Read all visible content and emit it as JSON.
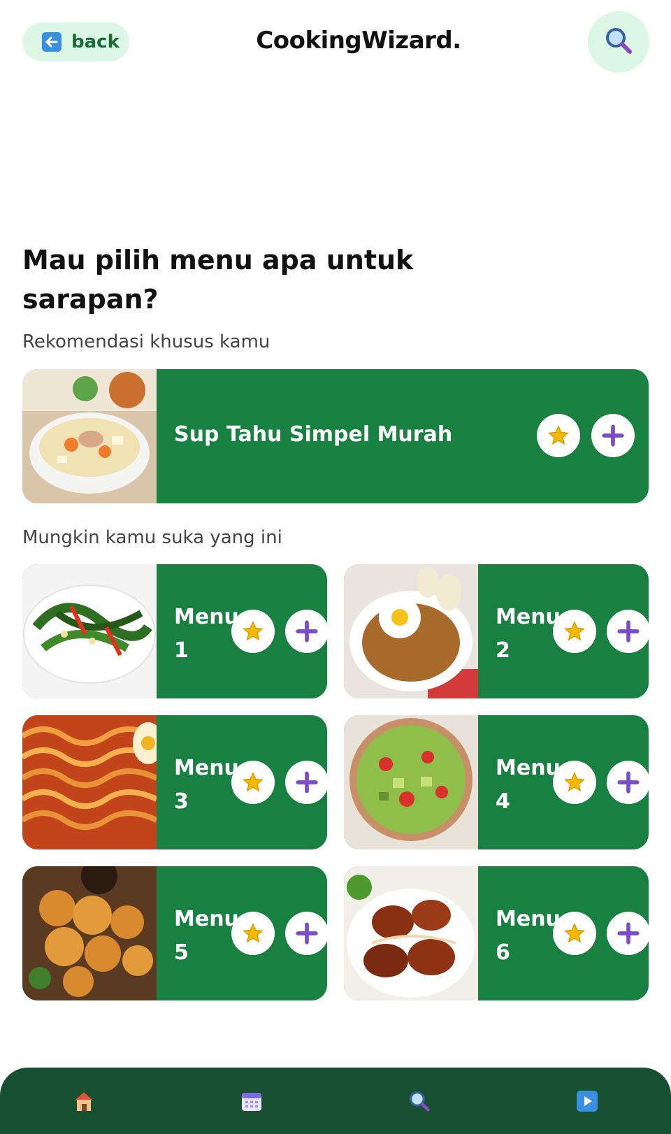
{
  "header": {
    "back_label": "back",
    "app_title": "CookingWizard."
  },
  "main": {
    "heading": "Mau pilih menu apa untuk sarapan?",
    "recommendation_label": "Rekomendasi khusus kamu",
    "recommended": {
      "title": "Sup Tahu Simpel Murah"
    },
    "suggestion_label": "Mungkin kamu suka yang ini",
    "menus": [
      {
        "title": "Menu 1"
      },
      {
        "title": "Menu 2"
      },
      {
        "title": "Menu 3"
      },
      {
        "title": "Menu 4"
      },
      {
        "title": "Menu 5"
      },
      {
        "title": "Menu 6"
      }
    ]
  },
  "bottom_nav": {
    "items": [
      "home-icon",
      "calendar-icon",
      "search-icon",
      "play-icon"
    ]
  },
  "colors": {
    "card_green": "#188040",
    "nav_green": "#165030",
    "chip_mint": "#dcf7e6",
    "plus_purple": "#7a4fc4",
    "star_gold": "#f5b800"
  }
}
